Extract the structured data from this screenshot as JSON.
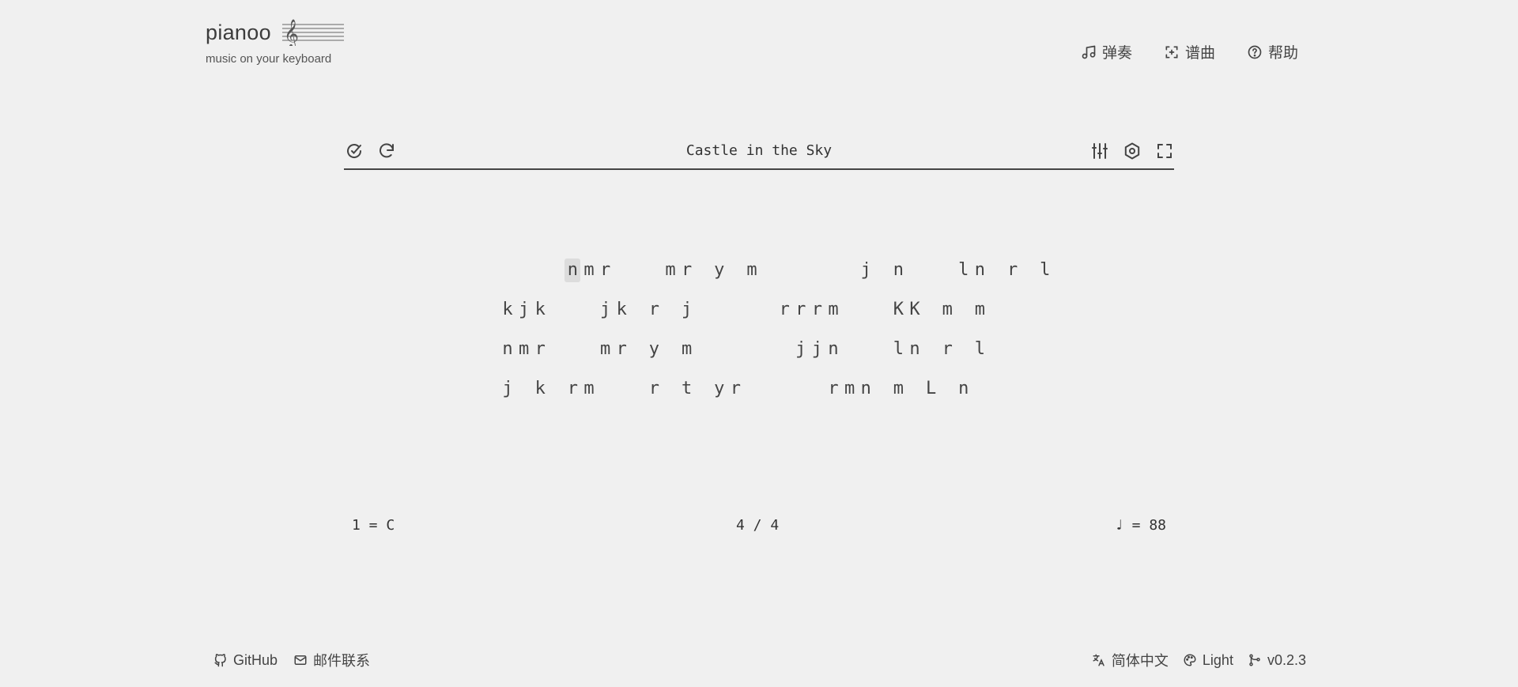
{
  "header": {
    "app_name": "pianoo",
    "tagline": "music on your keyboard"
  },
  "nav": [
    {
      "label": "弹奏",
      "icon": "music-note-icon"
    },
    {
      "label": "谱曲",
      "icon": "compose-icon"
    },
    {
      "label": "帮助",
      "icon": "help-icon"
    }
  ],
  "toolbar": {
    "title": "Castle in the Sky",
    "left_icons": [
      "autoplay-icon",
      "restart-icon"
    ],
    "right_icons": [
      "sliders-icon",
      "settings-icon",
      "fullscreen-icon"
    ]
  },
  "score": {
    "lines": [
      {
        "col_offset": 0,
        "text": "    nmr   mr y m      j n   ln r l"
      },
      {
        "col_offset": 0,
        "text": "kjk   jk r j     rrrm   KK m m"
      },
      {
        "col_offset": 0,
        "text": "nmr   mr y m      jjn   ln r l"
      },
      {
        "col_offset": 0,
        "text": "j k rm   r t yr     rmn m L n"
      }
    ],
    "active_note": "n"
  },
  "meta": {
    "key": "1 = C",
    "time_signature": "4 / 4",
    "tempo": "♩ = 88"
  },
  "footer": {
    "left": [
      {
        "label": "GitHub",
        "icon": "github-icon"
      },
      {
        "label": "邮件联系",
        "icon": "mail-icon"
      }
    ],
    "right": [
      {
        "label": "简体中文",
        "icon": "translate-icon"
      },
      {
        "label": "Light",
        "icon": "palette-icon"
      },
      {
        "label": "v0.2.3",
        "icon": "git-branch-icon"
      }
    ]
  }
}
